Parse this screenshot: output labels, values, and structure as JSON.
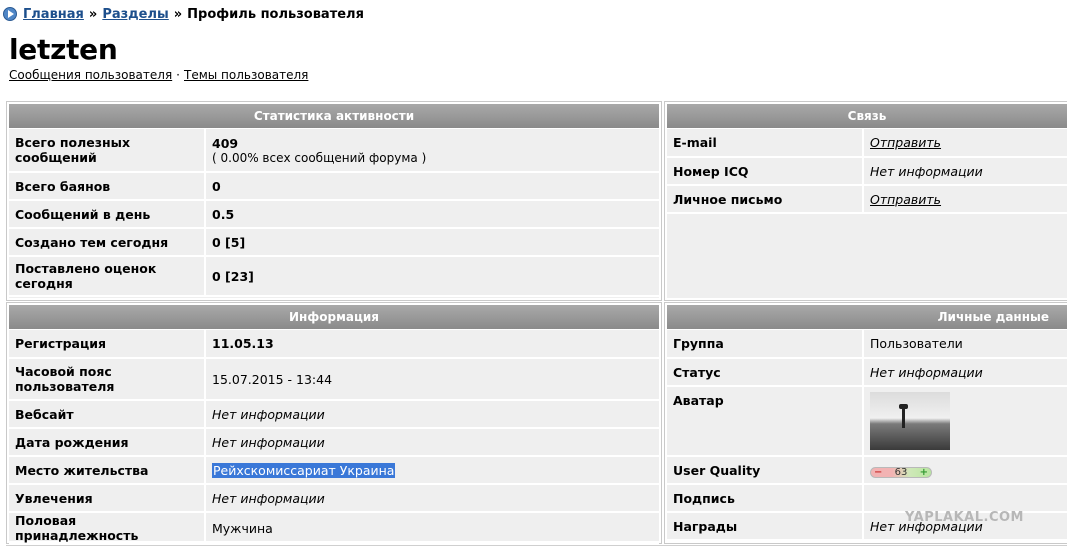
{
  "breadcrumb": {
    "home": "Главная",
    "sections": "Разделы",
    "separator": "»",
    "current": "Профиль пользователя"
  },
  "user": {
    "name": "letzten",
    "messages_link": "Сообщения пользователя",
    "dot": "·",
    "topics_link": "Темы пользователя"
  },
  "activity": {
    "title": "Статистика активности",
    "rows": [
      {
        "label": "Всего полезных сообщений",
        "value": "409",
        "sub": "( 0.00% всех сообщений форума )"
      },
      {
        "label": "Всего баянов",
        "value": "0"
      },
      {
        "label": "Сообщений в день",
        "value": "0.5"
      },
      {
        "label": "Создано тем сегодня",
        "value": "0 [5]"
      },
      {
        "label": "Поставлено оценок сегодня",
        "value": "0 [23]"
      }
    ]
  },
  "contact": {
    "title": "Связь",
    "rows": [
      {
        "label": "E-mail",
        "value": "Отправить"
      },
      {
        "label": "Номер ICQ",
        "value": "Нет информации"
      },
      {
        "label": "Личное письмо",
        "value": "Отправить"
      }
    ]
  },
  "info": {
    "title": "Информация",
    "rows": [
      {
        "label": "Регистрация",
        "value": "11.05.13"
      },
      {
        "label": "Часовой пояс пользователя",
        "value": "15.07.2015 - 13:44"
      },
      {
        "label": "Вебсайт",
        "value": "Нет информации"
      },
      {
        "label": "Дата рождения",
        "value": "Нет информации"
      },
      {
        "label": "Место жительства",
        "value": "Рейхскомиссариат Украина"
      },
      {
        "label": "Увлечения",
        "value": "Нет информации"
      },
      {
        "label": "Половая принадлежность",
        "value": "Мужчина"
      }
    ]
  },
  "personal": {
    "title": "Личные данные",
    "rows": [
      {
        "label": "Группа",
        "value": "Пользователи"
      },
      {
        "label": "Статус",
        "value": "Нет информации"
      },
      {
        "label": "Аватар"
      },
      {
        "label": "User Quality",
        "minus": "−",
        "value": "63",
        "plus": "+"
      },
      {
        "label": "Подпись",
        "value": ""
      },
      {
        "label": "Награды",
        "value": "Нет информации"
      }
    ]
  },
  "watermark": "YAPLAKAL.COM"
}
